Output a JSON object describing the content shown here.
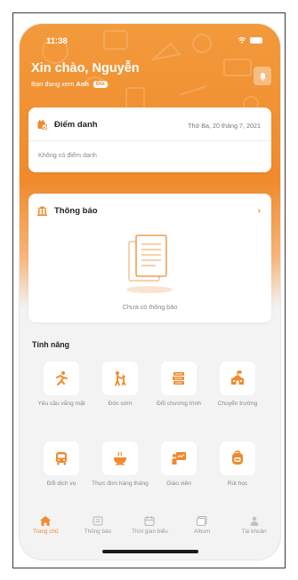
{
  "status_bar": {
    "time": "11:38"
  },
  "header": {
    "greeting": "Xin chào, Nguyễn",
    "viewing_prefix": "Bạn đang xem",
    "viewing_name": "Anh",
    "change_label": "Đổi"
  },
  "attendance_card": {
    "title": "Điểm danh",
    "date": "Thứ Ba, 20 tháng 7, 2021",
    "empty_text": "Không có điểm danh"
  },
  "notification_card": {
    "title": "Thông báo",
    "empty_text": "Chưa có thông báo"
  },
  "features": {
    "title": "Tính năng",
    "items": [
      {
        "label": "Yêu cầu vắng mặt",
        "icon": "running-person-icon"
      },
      {
        "label": "Đón sớm",
        "icon": "parent-child-icon"
      },
      {
        "label": "Đổi chương trình",
        "icon": "books-stack-icon"
      },
      {
        "label": "Chuyển trường",
        "icon": "school-building-icon"
      },
      {
        "label": "Đổi dịch vụ",
        "icon": "school-bus-icon"
      },
      {
        "label": "Thực đơn hàng tháng",
        "icon": "food-bowl-icon"
      },
      {
        "label": "Giáo viên",
        "icon": "teacher-board-icon"
      },
      {
        "label": "Rút học",
        "icon": "backpack-icon"
      }
    ]
  },
  "tab_bar": {
    "items": [
      {
        "label": "Trang chủ",
        "icon": "home-icon",
        "active": true
      },
      {
        "label": "Thông báo",
        "icon": "megaphone-icon",
        "active": false
      },
      {
        "label": "Thời gian biểu",
        "icon": "calendar-icon",
        "active": false
      },
      {
        "label": "Album",
        "icon": "album-icon",
        "active": false
      },
      {
        "label": "Tài khoản",
        "icon": "person-icon",
        "active": false
      }
    ]
  },
  "colors": {
    "brand": "#f08a2c",
    "header_top": "#f29a3c",
    "background": "#f3f3f3",
    "muted_text": "#888888"
  }
}
